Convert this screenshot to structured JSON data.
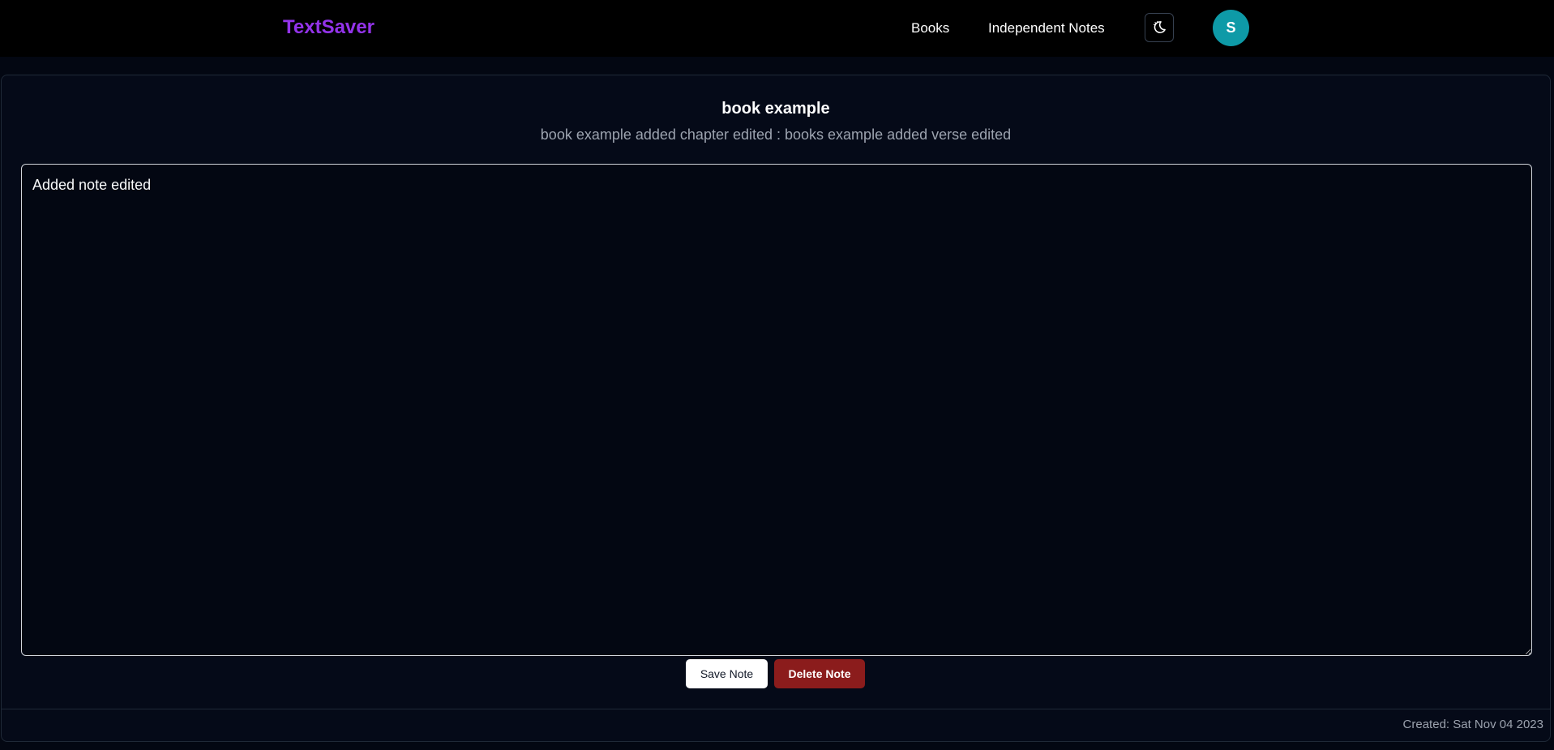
{
  "navbar": {
    "brand": "TextSaver",
    "links": [
      {
        "label": "Books"
      },
      {
        "label": "Independent Notes"
      }
    ],
    "theme_toggle_icon": "moon-icon",
    "avatar_initial": "S",
    "colors": {
      "brand": "#9333ea",
      "avatar": "#0e9aa7",
      "background": "#000000"
    }
  },
  "note": {
    "book_title": "book example",
    "subtitle": "book example added chapter edited : books example added verse edited",
    "content": "Added note edited",
    "save_label": "Save Note",
    "delete_label": "Delete Note",
    "created": "Created: Sat Nov 04 2023",
    "colors": {
      "delete_button": "#8b1c1c",
      "save_button": "#ffffff"
    }
  }
}
